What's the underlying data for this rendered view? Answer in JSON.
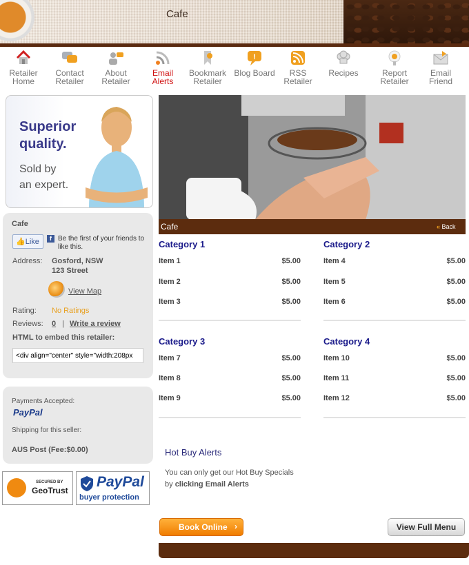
{
  "header": {
    "title": "Cafe"
  },
  "nav": [
    {
      "label": "Retailer Home",
      "icon": "home-icon"
    },
    {
      "label": "Contact Retailer",
      "icon": "chat-icon"
    },
    {
      "label": "About Retailer",
      "icon": "users-icon"
    },
    {
      "label": "Email Alerts",
      "icon": "rss-icon",
      "active": true
    },
    {
      "label": "Bookmark Retailer",
      "icon": "bookmark-icon"
    },
    {
      "label": "Blog Board",
      "icon": "speech-bubble-icon"
    },
    {
      "label": "RSS Retailer",
      "icon": "rss-feed-icon"
    },
    {
      "label": "Recipes",
      "icon": "chef-hat-icon"
    },
    {
      "label": "Report Retailer",
      "icon": "alert-icon"
    },
    {
      "label": "Email Friend",
      "icon": "mail-icon"
    }
  ],
  "ad": {
    "line1": "Superior",
    "line2": "quality.",
    "line3": "Sold by",
    "line4": "an expert."
  },
  "retailer": {
    "name": "Cafe",
    "like_label": "Like",
    "like_text": "Be the first of your friends to like this.",
    "address_label": "Address:",
    "address_line1": "Gosford, NSW",
    "address_line2": "123 Street",
    "map_link": "View Map",
    "rating_label": "Rating:",
    "rating_value": "No Ratings",
    "reviews_label": "Reviews:",
    "reviews_count": "0",
    "reviews_sep": "|",
    "write_review": "Write a review",
    "embed_label": "HTML to embed this retailer:",
    "embed_code": "<div align=\"center\" style=\"width:208px"
  },
  "payments": {
    "label": "Payments Accepted:",
    "paypal": "PayPal",
    "shipping_label": "Shipping for this seller:",
    "shipping_value": "AUS Post (Fee:$0.00)"
  },
  "badges": {
    "geotrust_small": "SECURED BY",
    "geotrust": "GeoTrust",
    "paypal": "PayPal",
    "paypal_sub": "buyer protection"
  },
  "menu": {
    "title": "Cafe",
    "back": "Back",
    "categories": [
      {
        "name": "Category 1",
        "items": [
          {
            "name": "Item 1",
            "price": "$5.00"
          },
          {
            "name": "Item 2",
            "price": "$5.00"
          },
          {
            "name": "Item 3",
            "price": "$5.00"
          }
        ]
      },
      {
        "name": "Category 2",
        "items": [
          {
            "name": "Item 4",
            "price": "$5.00"
          },
          {
            "name": "Item 5",
            "price": "$5.00"
          },
          {
            "name": "Item 6",
            "price": "$5.00"
          }
        ]
      },
      {
        "name": "Category 3",
        "items": [
          {
            "name": "Item 7",
            "price": "$5.00"
          },
          {
            "name": "Item 8",
            "price": "$5.00"
          },
          {
            "name": "Item 9",
            "price": "$5.00"
          }
        ]
      },
      {
        "name": "Category 4",
        "items": [
          {
            "name": "Item 10",
            "price": "$5.00"
          },
          {
            "name": "Item 11",
            "price": "$5.00"
          },
          {
            "name": "Item 12",
            "price": "$5.00"
          }
        ]
      }
    ]
  },
  "hotbuy": {
    "title": "Hot Buy Alerts",
    "text1": "You can only get our Hot Buy Specials",
    "text2": "by ",
    "text2_bold": "clicking Email Alerts"
  },
  "buttons": {
    "book_online": "Book Online",
    "view_full_menu": "View Full Menu"
  },
  "colors": {
    "brown": "#5c2c0e",
    "link_blue": "#1a1a8a",
    "active_red": "#d01010",
    "rating_orange": "#e8a020"
  }
}
